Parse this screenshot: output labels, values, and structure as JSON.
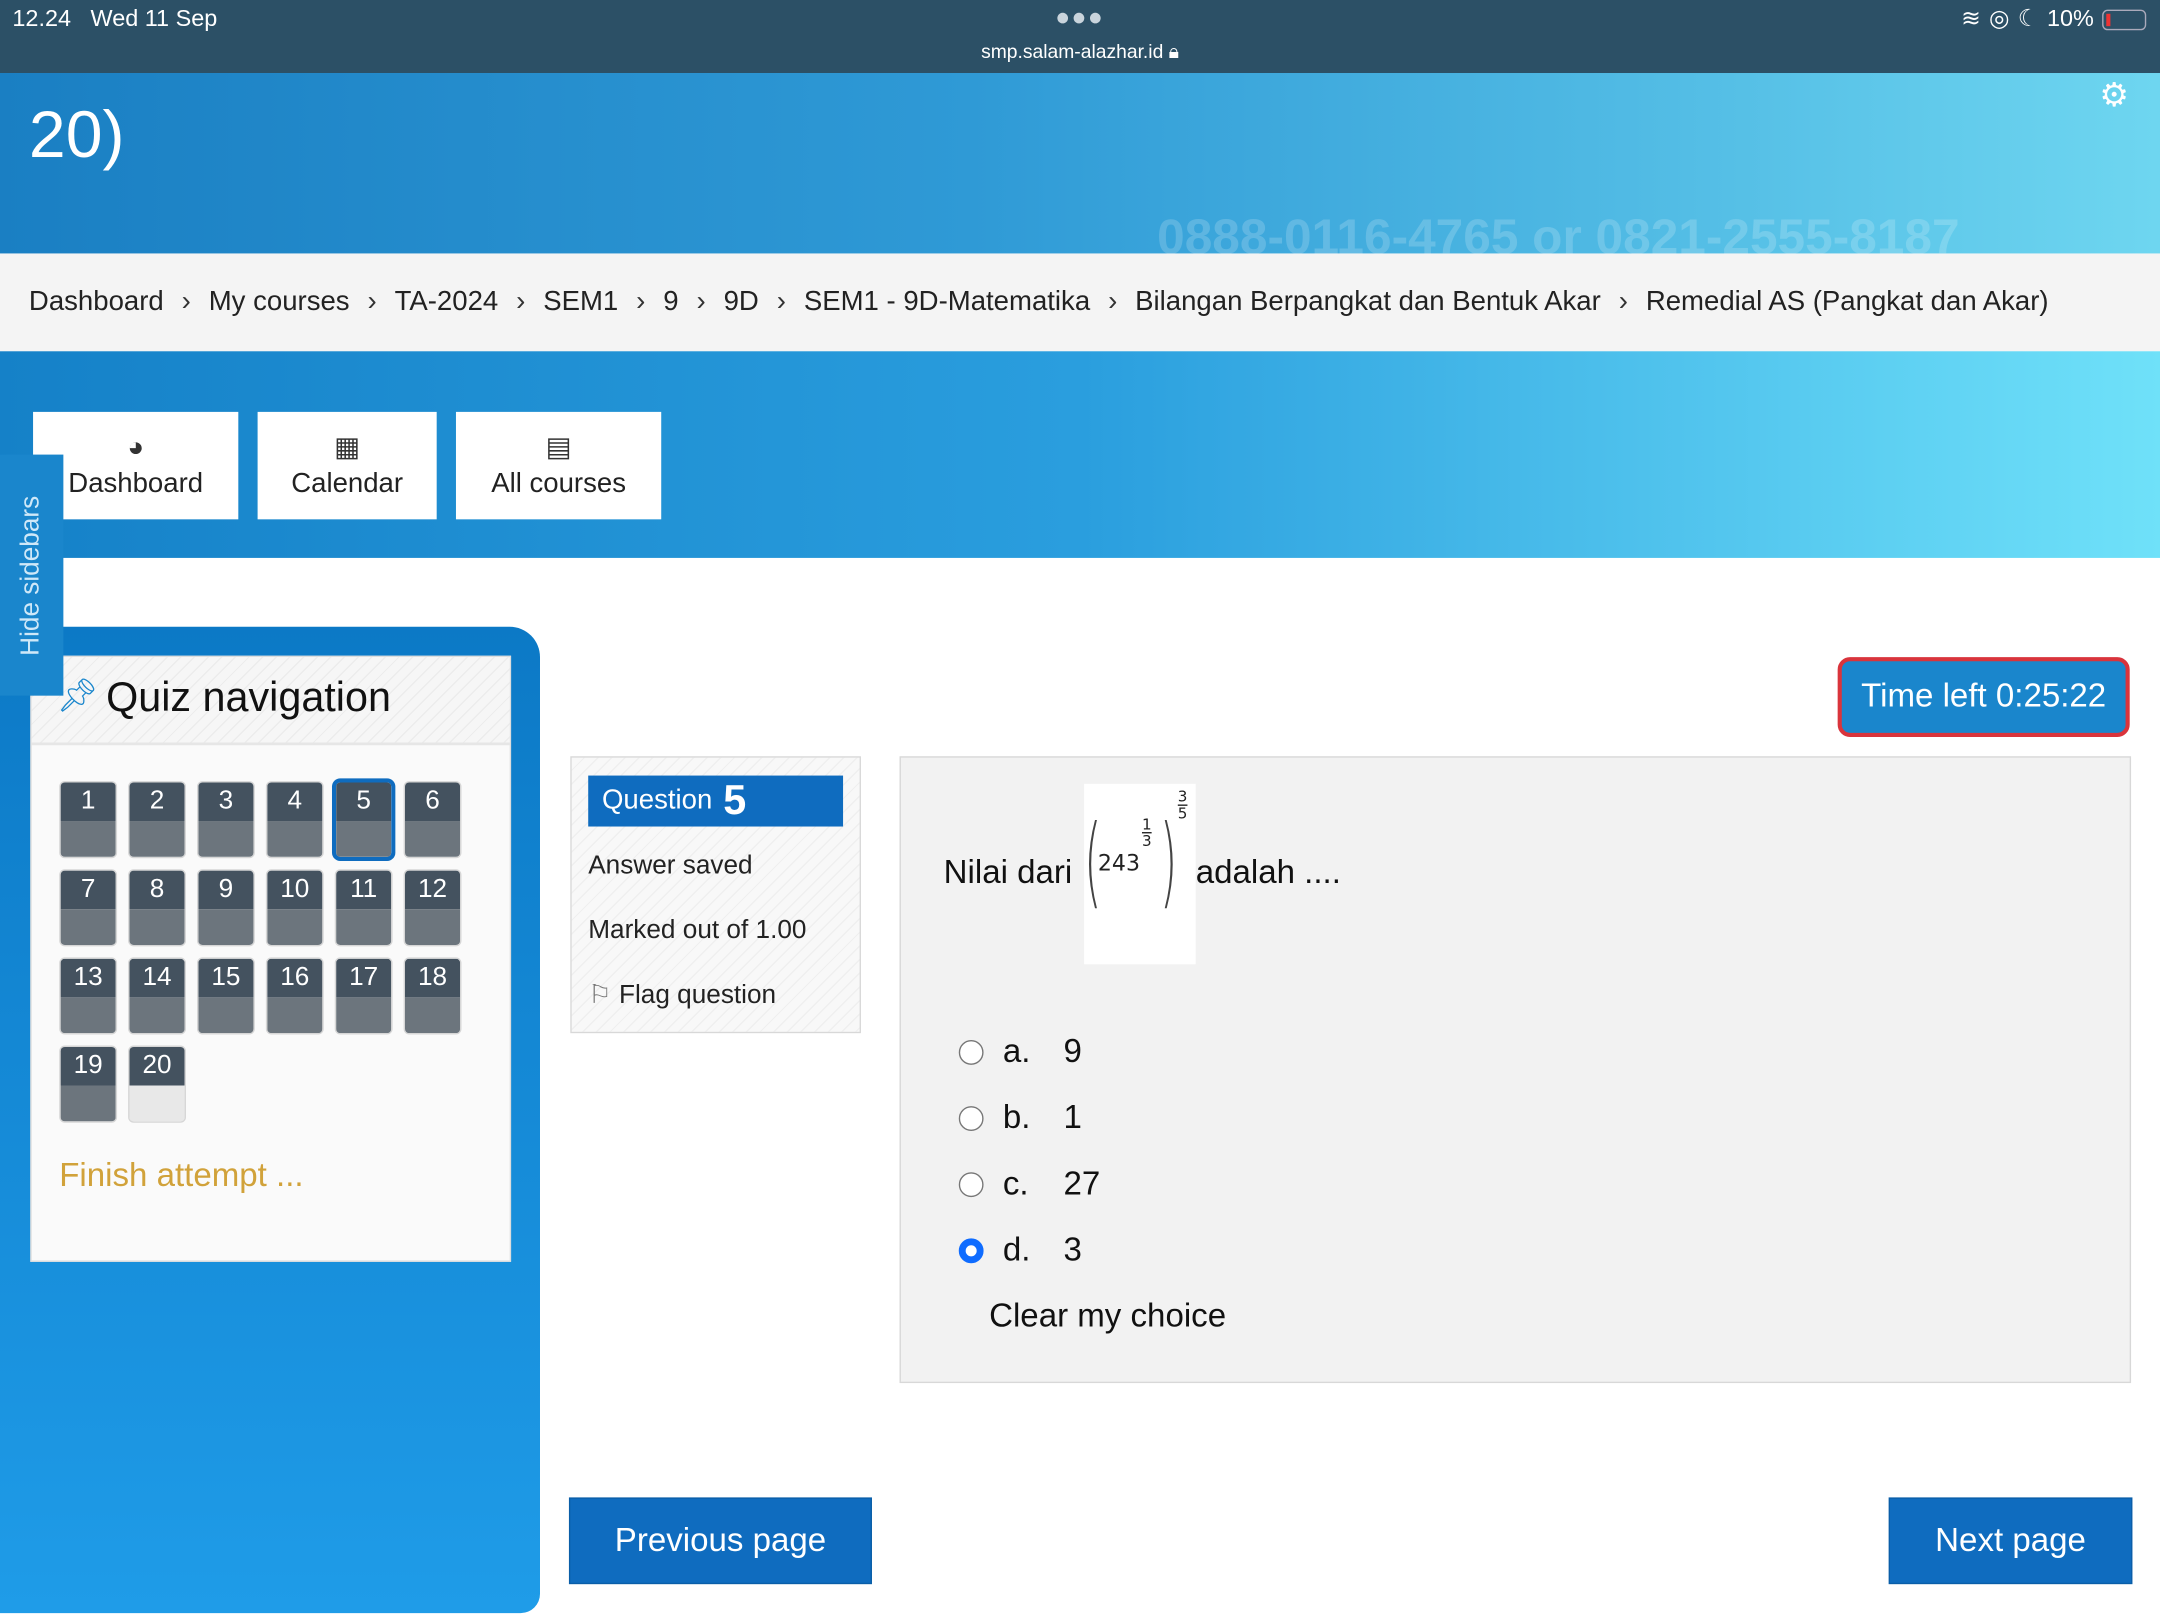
{
  "status_bar": {
    "time": "12.24",
    "date": "Wed 11 Sep",
    "url": "smp.salam-alazhar.id",
    "battery": "10%"
  },
  "header": {
    "title_visible": "20)",
    "background_text": "0888-0116-4765 or 0821-2555-8187"
  },
  "breadcrumb": [
    "Dashboard",
    "My courses",
    "TA-2024",
    "SEM1",
    "9",
    "9D",
    "SEM1 - 9D-Matematika",
    "Bilangan Berpangkat dan Bentuk Akar",
    "Remedial AS (Pangkat dan Akar)"
  ],
  "nav_buttons": [
    {
      "label": "Dashboard",
      "icon": "dashboard-gauge-icon"
    },
    {
      "label": "Calendar",
      "icon": "calendar-icon"
    },
    {
      "label": "All courses",
      "icon": "book-icon"
    }
  ],
  "hide_sidebars": "Hide sidebars",
  "quiz_nav": {
    "title": "Quiz navigation",
    "questions": [
      "1",
      "2",
      "3",
      "4",
      "5",
      "6",
      "7",
      "8",
      "9",
      "10",
      "11",
      "12",
      "13",
      "14",
      "15",
      "16",
      "17",
      "18",
      "19",
      "20"
    ],
    "current": 5,
    "unanswered": [
      20
    ],
    "finish": "Finish attempt ..."
  },
  "timer": "Time left 0:25:22",
  "question_info": {
    "label": "Question",
    "number": "5",
    "state": "Answer saved",
    "marks": "Marked out of 1.00",
    "flag": "Flag question"
  },
  "question": {
    "prefix": "Nilai dari",
    "math": {
      "base": "243",
      "inner_exp_num": "1",
      "inner_exp_den": "3",
      "outer_exp_num": "3",
      "outer_exp_den": "5"
    },
    "suffix": "adalah ....",
    "options": [
      {
        "letter": "a.",
        "value": "9",
        "selected": false
      },
      {
        "letter": "b.",
        "value": "1",
        "selected": false
      },
      {
        "letter": "c.",
        "value": "27",
        "selected": false
      },
      {
        "letter": "d.",
        "value": "3",
        "selected": true
      }
    ],
    "clear": "Clear my choice"
  },
  "pager": {
    "previous": "Previous page",
    "next": "Next page"
  },
  "colors": {
    "primary": "#0f6cbf",
    "timer_border": "#d9343c",
    "finish_link": "#d1a23a",
    "status_bar": "#2c5066"
  }
}
